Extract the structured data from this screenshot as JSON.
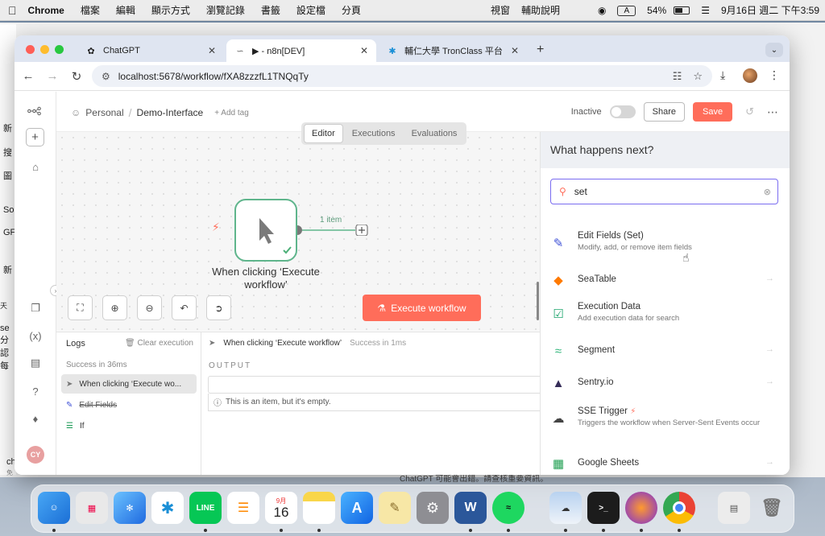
{
  "menubar": {
    "app": "Chrome",
    "items": [
      "檔案",
      "編輯",
      "顯示方式",
      "瀏覽記錄",
      "書籤",
      "設定檔",
      "分頁"
    ],
    "right": [
      "視窗",
      "輔助說明"
    ],
    "input": "A",
    "battery": "54%",
    "clock": "9月16日 週二 下午3:59"
  },
  "background": {
    "left_snippets": [
      "新",
      "搜",
      "圖",
      "So",
      "GF",
      "新",
      "天",
      "se 分",
      "認每",
      "ch",
      "免"
    ],
    "behind_text": "ChatGPT 可能會出錯。請查核重要資訊。"
  },
  "browser": {
    "tabs": [
      {
        "title": "ChatGPT",
        "active": false
      },
      {
        "title": "▶ - n8n[DEV]",
        "active": true
      },
      {
        "title": "輔仁大學 TronClass 平台",
        "active": false
      }
    ],
    "url": "localhost:5678/workflow/fXA8zzzfL1TNQqTy"
  },
  "header": {
    "project": "Personal",
    "workflow_name": "Demo-Interface",
    "add_tag": "+ Add tag",
    "status": "Inactive",
    "share": "Share",
    "save": "Save"
  },
  "view_tabs": [
    "Editor",
    "Executions",
    "Evaluations"
  ],
  "canvas": {
    "node_label": "When clicking ‘Execute workflow’",
    "item_count": "1 item",
    "execute_button": "Execute workflow"
  },
  "logs": {
    "title": "Logs",
    "clear": "Clear execution",
    "success": "Success in 36ms",
    "rows": [
      "When clicking ‘Execute wo...",
      "Edit Fields",
      "If"
    ],
    "exec_node": "When clicking ‘Execute workflow’",
    "exec_status": "Success in 1ms",
    "output_label": "OUTPUT",
    "empty_msg": "This is an item, but it's empty."
  },
  "panel": {
    "title": "What happens next?",
    "search_value": "set",
    "results": [
      {
        "title": "Edit Fields (Set)",
        "desc": "Modify, add, or remove item fields",
        "icon": "pencil-icon"
      },
      {
        "title": "SeaTable",
        "desc": "",
        "icon": "seatable-icon"
      },
      {
        "title": "Execution Data",
        "desc": "Add execution data for search",
        "icon": "list-check-icon"
      },
      {
        "title": "Segment",
        "desc": "",
        "icon": "segment-icon"
      },
      {
        "title": "Sentry.io",
        "desc": "",
        "icon": "sentry-icon"
      },
      {
        "title": "SSE Trigger",
        "desc": "Triggers the workflow when Server-Sent Events occur",
        "icon": "cloud-download-icon"
      },
      {
        "title": "Google Sheets",
        "desc": "",
        "icon": "sheets-icon"
      }
    ]
  },
  "dock": {
    "calendar_month": "9月",
    "calendar_day": "16",
    "line_label": "LINE"
  },
  "colors": {
    "accent": "#ff6d5a",
    "node_green": "#5fb58c",
    "search_focus": "#7a6cf0"
  }
}
